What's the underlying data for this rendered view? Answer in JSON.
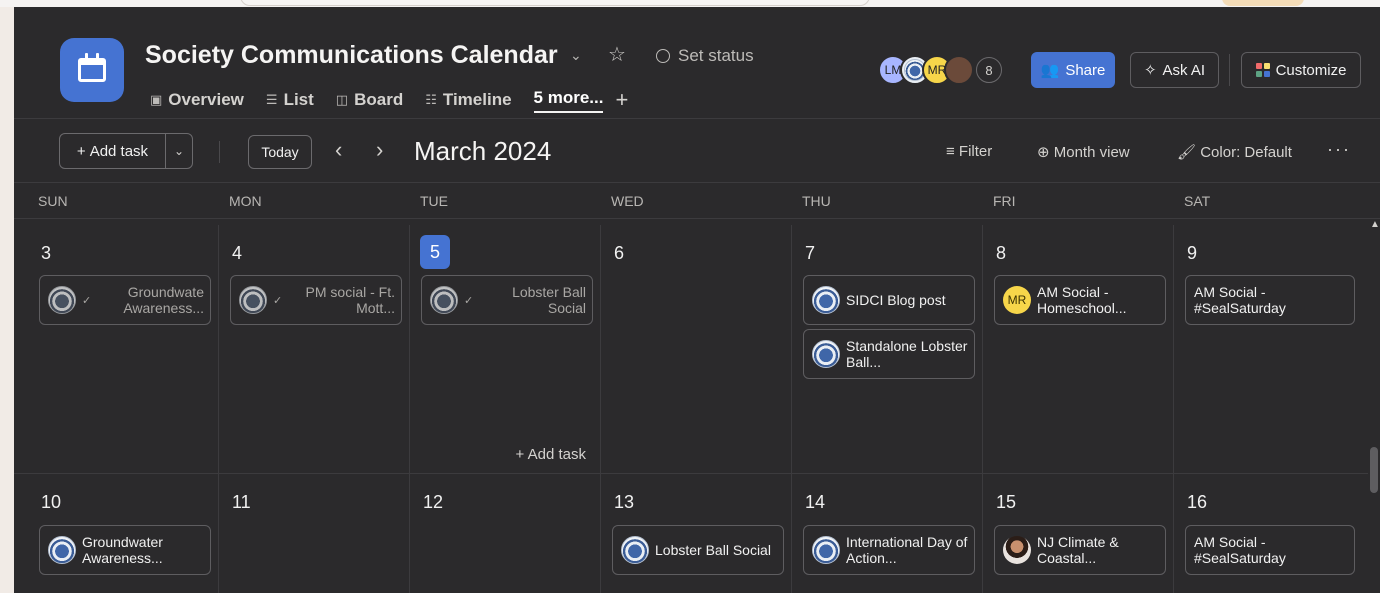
{
  "project": {
    "title": "Society Communications Calendar",
    "set_status": "Set status"
  },
  "tabs": [
    {
      "label": "Overview",
      "icon": "overview-icon"
    },
    {
      "label": "List",
      "icon": "list-icon"
    },
    {
      "label": "Board",
      "icon": "board-icon"
    },
    {
      "label": "Timeline",
      "icon": "timeline-icon"
    },
    {
      "label": "5 more...",
      "icon": ""
    }
  ],
  "members": {
    "initials": [
      "LM",
      "MR"
    ],
    "count": "8"
  },
  "actions": {
    "share": "Share",
    "ask_ai": "Ask AI",
    "customize": "Customize"
  },
  "toolbar": {
    "add_task": "Add task",
    "today": "Today",
    "month_label": "March 2024",
    "filter": "Filter",
    "month_view": "Month view",
    "color": "Color: Default"
  },
  "day_headers": [
    "SUN",
    "MON",
    "TUE",
    "WED",
    "THU",
    "FRI",
    "SAT"
  ],
  "weeks": [
    {
      "days": [
        {
          "num": "3",
          "tasks": [
            {
              "text": "Groundwate Awareness...",
              "done": true,
              "avatar": "seal"
            }
          ]
        },
        {
          "num": "4",
          "tasks": [
            {
              "text": "PM social - Ft. Mott...",
              "done": true,
              "avatar": "seal"
            }
          ]
        },
        {
          "num": "5",
          "today": true,
          "tasks": [
            {
              "text": "Lobster Ball Social",
              "done": true,
              "avatar": "seal"
            }
          ],
          "add_task": "Add task"
        },
        {
          "num": "6",
          "tasks": []
        },
        {
          "num": "7",
          "tasks": [
            {
              "text": "SIDCI Blog post",
              "done": false,
              "avatar": "seal"
            },
            {
              "text": "Standalone Lobster Ball...",
              "done": false,
              "avatar": "seal"
            }
          ]
        },
        {
          "num": "8",
          "tasks": [
            {
              "text": "AM Social - Homeschool...",
              "done": false,
              "avatar": "mr",
              "initials": "MR"
            }
          ]
        },
        {
          "num": "9",
          "tasks": [
            {
              "text": "AM Social - #SealSaturday",
              "done": false,
              "avatar": "none"
            }
          ]
        }
      ]
    },
    {
      "days": [
        {
          "num": "10",
          "tasks": [
            {
              "text": "Groundwater Awareness...",
              "done": false,
              "avatar": "seal"
            }
          ]
        },
        {
          "num": "11",
          "tasks": []
        },
        {
          "num": "12",
          "tasks": []
        },
        {
          "num": "13",
          "tasks": [
            {
              "text": "Lobster Ball Social",
              "done": false,
              "avatar": "seal"
            }
          ]
        },
        {
          "num": "14",
          "tasks": [
            {
              "text": "International Day of Action...",
              "done": false,
              "avatar": "seal"
            }
          ]
        },
        {
          "num": "15",
          "tasks": [
            {
              "text": "NJ Climate & Coastal...",
              "done": false,
              "avatar": "photo"
            }
          ]
        },
        {
          "num": "16",
          "tasks": [
            {
              "text": "AM Social - #SealSaturday",
              "done": false,
              "avatar": "none"
            }
          ]
        }
      ]
    }
  ],
  "colors": {
    "accent": "#4573d2",
    "background": "#2b2a2c",
    "mr_avatar": "#f7d64a"
  }
}
